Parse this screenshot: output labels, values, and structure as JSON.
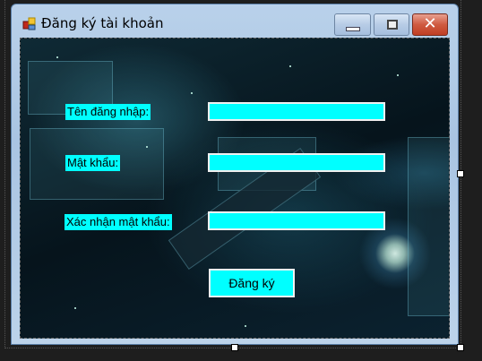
{
  "window": {
    "title": "Đăng ký tài khoản",
    "minimize": "—",
    "maximize": "□",
    "close": "✕",
    "app_icon": "form-icon"
  },
  "form": {
    "username_label": "Tên đăng nhập:",
    "password_label": "Mật khẩu:",
    "confirm_label": "Xác nhận mật khẩu:",
    "username_value": "",
    "password_value": "",
    "confirm_value": "",
    "register_button": "Đăng ký"
  },
  "colors": {
    "field_bg": "#00ffff",
    "close_button": "#c8452a"
  }
}
